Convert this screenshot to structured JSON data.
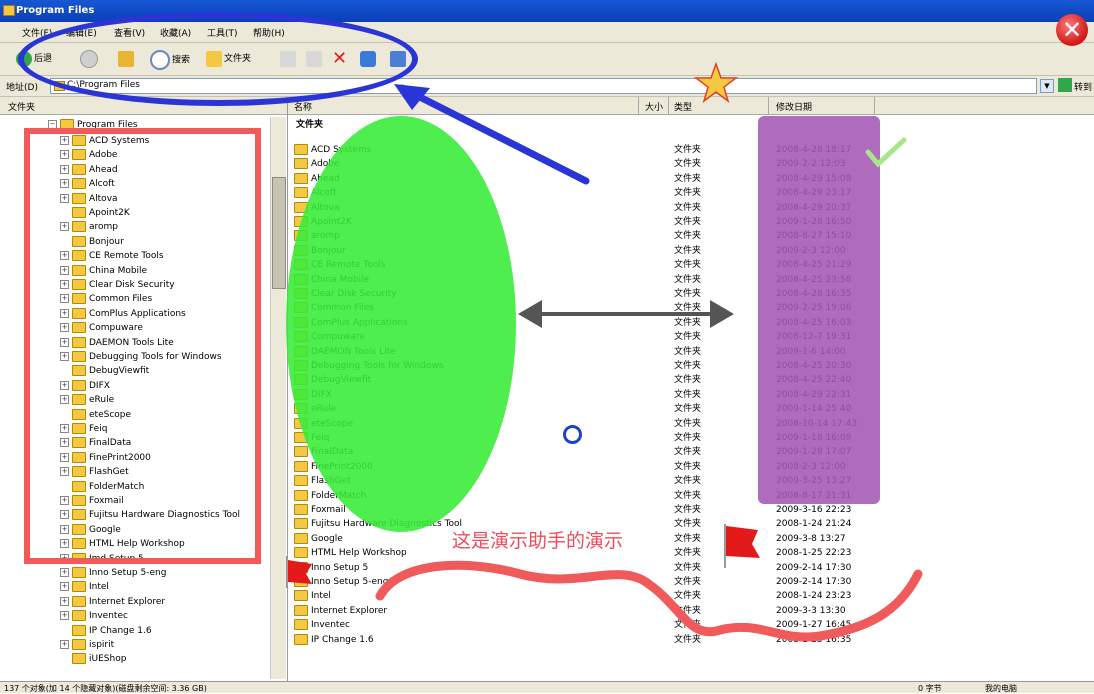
{
  "window": {
    "title": "Program Files"
  },
  "menu": [
    {
      "label": "文件(F)"
    },
    {
      "label": "编辑(E)"
    },
    {
      "label": "查看(V)"
    },
    {
      "label": "收藏(A)"
    },
    {
      "label": "工具(T)"
    },
    {
      "label": "帮助(H)"
    }
  ],
  "toolbar": {
    "back": "后退",
    "search": "搜索",
    "folders": "文件夹"
  },
  "address": {
    "label": "地址(D)",
    "value": "C:\\Program Files",
    "go": "转到"
  },
  "tree": {
    "header": "文件夹",
    "root": "Program Files",
    "items": [
      {
        "label": "ACD Systems",
        "expand": "+"
      },
      {
        "label": "Adobe",
        "expand": "+"
      },
      {
        "label": "Ahead",
        "expand": "+"
      },
      {
        "label": "Alcoft",
        "expand": "+"
      },
      {
        "label": "Altova",
        "expand": "+"
      },
      {
        "label": "Apoint2K",
        "expand": ""
      },
      {
        "label": "aromp",
        "expand": "+"
      },
      {
        "label": "Bonjour",
        "expand": ""
      },
      {
        "label": "CE Remote Tools",
        "expand": "+"
      },
      {
        "label": "China Mobile",
        "expand": "+"
      },
      {
        "label": "Clear Disk Security",
        "expand": "+"
      },
      {
        "label": "Common Files",
        "expand": "+"
      },
      {
        "label": "ComPlus Applications",
        "expand": "+"
      },
      {
        "label": "Compuware",
        "expand": "+"
      },
      {
        "label": "DAEMON Tools Lite",
        "expand": "+"
      },
      {
        "label": "Debugging Tools for Windows",
        "expand": "+"
      },
      {
        "label": "DebugViewfit",
        "expand": ""
      },
      {
        "label": "DIFX",
        "expand": "+"
      },
      {
        "label": "eRule",
        "expand": "+"
      },
      {
        "label": "eteScope",
        "expand": ""
      },
      {
        "label": "Feiq",
        "expand": "+"
      },
      {
        "label": "FinalData",
        "expand": "+"
      },
      {
        "label": "FinePrint2000",
        "expand": "+"
      },
      {
        "label": "FlashGet",
        "expand": "+"
      },
      {
        "label": "FolderMatch",
        "expand": ""
      },
      {
        "label": "Foxmail",
        "expand": "+"
      },
      {
        "label": "Fujitsu Hardware Diagnostics Tool",
        "expand": "+"
      },
      {
        "label": "Google",
        "expand": "+"
      },
      {
        "label": "HTML Help Workshop",
        "expand": "+"
      },
      {
        "label": "Imd Setup 5",
        "expand": "+"
      },
      {
        "label": "Inno Setup 5-eng",
        "expand": "+"
      },
      {
        "label": "Intel",
        "expand": "+"
      },
      {
        "label": "Internet Explorer",
        "expand": "+"
      },
      {
        "label": "Inventec",
        "expand": "+"
      },
      {
        "label": "IP Change 1.6",
        "expand": ""
      },
      {
        "label": "ispirit",
        "expand": "+"
      },
      {
        "label": "iUEShop",
        "expand": ""
      }
    ]
  },
  "columns": {
    "name": "名称",
    "size": "大小",
    "type": "类型",
    "modified": "修改日期"
  },
  "group_label": "文件夹",
  "files": [
    {
      "name": "ACD Systems",
      "type": "文件夹",
      "date": "2008-4-28 18:17"
    },
    {
      "name": "Adobe",
      "type": "文件夹",
      "date": "2009-2-2 12:03"
    },
    {
      "name": "Ahead",
      "type": "文件夹",
      "date": "2008-4-29 15:08"
    },
    {
      "name": "Alcoft",
      "type": "文件夹",
      "date": "2008-4-29 23:17"
    },
    {
      "name": "Altova",
      "type": "文件夹",
      "date": "2008-4-29 20:37"
    },
    {
      "name": "Apoint2K",
      "type": "文件夹",
      "date": "2009-1-28 16:50"
    },
    {
      "name": "aromp",
      "type": "文件夹",
      "date": "2008-8-27 15:10"
    },
    {
      "name": "Bonjour",
      "type": "文件夹",
      "date": "2009-2-3 12:00"
    },
    {
      "name": "CE Remote Tools",
      "type": "文件夹",
      "date": "2008-4-25 21:29"
    },
    {
      "name": "China Mobile",
      "type": "文件夹",
      "date": "2008-4-25 23:58"
    },
    {
      "name": "Clear Disk Security",
      "type": "文件夹",
      "date": "2008-4-28 16:35"
    },
    {
      "name": "Common Files",
      "type": "文件夹",
      "date": "2009-2-25 19:06"
    },
    {
      "name": "ComPlus Applications",
      "type": "文件夹",
      "date": "2008-4-25 16:03"
    },
    {
      "name": "Compuware",
      "type": "文件夹",
      "date": "2008-12-7 19:31"
    },
    {
      "name": "DAEMON Tools Lite",
      "type": "文件夹",
      "date": "2009-1-6 14:00"
    },
    {
      "name": "Debugging Tools for Windows",
      "type": "文件夹",
      "date": "2008-4-25 20:30"
    },
    {
      "name": "DebugViewfit",
      "type": "文件夹",
      "date": "2008-4-25 22:40"
    },
    {
      "name": "DIFX",
      "type": "文件夹",
      "date": "2008-4-29 22:31"
    },
    {
      "name": "eRule",
      "type": "文件夹",
      "date": "2009-1-14 25 40"
    },
    {
      "name": "eteScope",
      "type": "文件夹",
      "date": "2008-10-14 17:43"
    },
    {
      "name": "Feiq",
      "type": "文件夹",
      "date": "2009-1-18 16:09"
    },
    {
      "name": "FinalData",
      "type": "文件夹",
      "date": "2009-1-28 17:07"
    },
    {
      "name": "FinePrint2000",
      "type": "文件夹",
      "date": "2008-2-3 12:00"
    },
    {
      "name": "FlashGet",
      "type": "文件夹",
      "date": "2009-3-25 13:27"
    },
    {
      "name": "FolderMatch",
      "type": "文件夹",
      "date": "2008-8-17 21:31"
    },
    {
      "name": "Foxmail",
      "type": "文件夹",
      "date": "2009-3-16 22:23"
    },
    {
      "name": "Fujitsu Hardware Diagnostics Tool",
      "type": "文件夹",
      "date": "2008-1-24 21:24"
    },
    {
      "name": "Google",
      "type": "文件夹",
      "date": "2009-3-8 13:27"
    },
    {
      "name": "HTML Help Workshop",
      "type": "文件夹",
      "date": "2008-1-25 22:23"
    },
    {
      "name": "Inno Setup 5",
      "type": "文件夹",
      "date": "2009-2-14 17:30"
    },
    {
      "name": "Inno Setup 5-eng",
      "type": "文件夹",
      "date": "2009-2-14 17:30"
    },
    {
      "name": "Intel",
      "type": "文件夹",
      "date": "2008-1-24 23:23"
    },
    {
      "name": "Internet Explorer",
      "type": "文件夹",
      "date": "2009-3-3 13:30"
    },
    {
      "name": "Inventec",
      "type": "文件夹",
      "date": "2009-1-27 16:45"
    },
    {
      "name": "IP Change 1.6",
      "type": "文件夹",
      "date": "2008-1-25 16:35"
    }
  ],
  "status": {
    "left": "137 个对象(加 14 个隐藏对象)(磁盘剩余空间: 3.36 GB)",
    "size": "0 字节",
    "location": "我的电脑"
  },
  "annotation": {
    "text": "这是演示助手的演示"
  },
  "colors": {
    "annotation_blue": "#2b35d6",
    "annotation_red": "#f05a5a",
    "annotation_green": "#37ec37",
    "annotation_purple": "#a457b4",
    "title_blue": "#0b3fb8"
  }
}
